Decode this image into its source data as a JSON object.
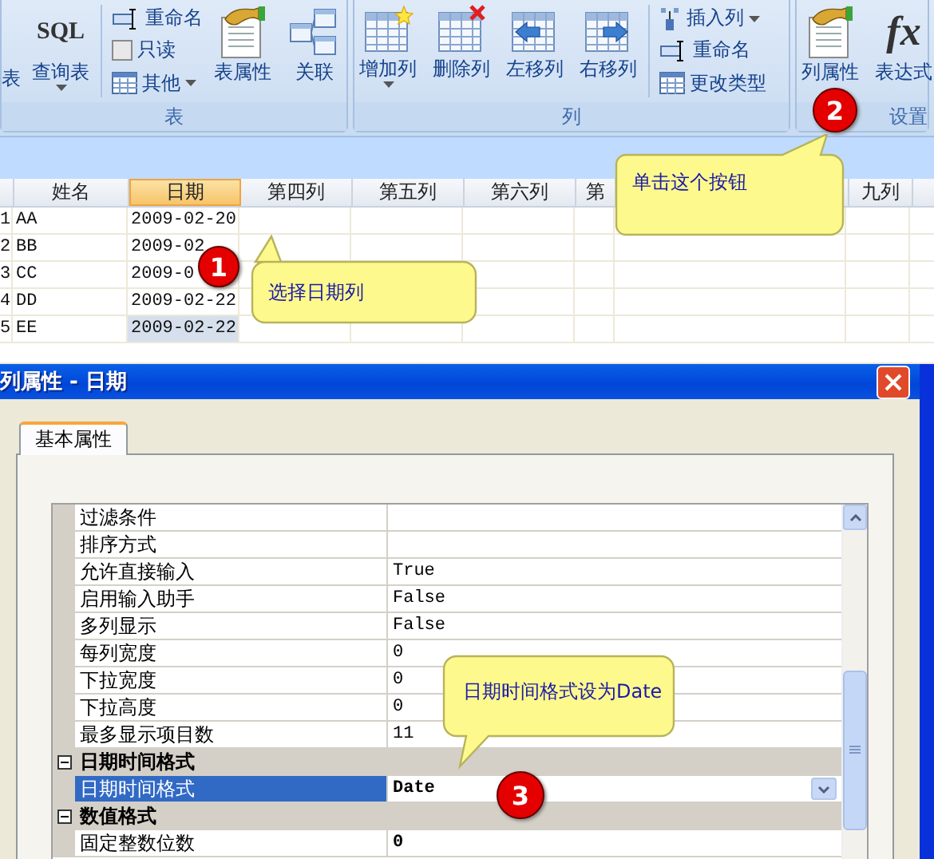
{
  "ribbon": {
    "groups": [
      {
        "label": "表",
        "items": [
          {
            "kind": "partial",
            "label": "表"
          },
          {
            "kind": "large",
            "label": "查询表",
            "icon_text": "SQL",
            "dropdown": true
          },
          {
            "kind": "stack",
            "items": [
              {
                "kind": "rename",
                "label": "重命名"
              },
              {
                "kind": "check",
                "label": "只读",
                "checked": false
              },
              {
                "kind": "grid",
                "label": "其他",
                "dropdown": true
              }
            ]
          },
          {
            "kind": "large",
            "label": "表属性",
            "dropdown": false
          },
          {
            "kind": "large",
            "label": "关联",
            "dropdown": false
          }
        ]
      },
      {
        "label": "列",
        "items": [
          {
            "kind": "large",
            "label": "增加列",
            "dropdown": true
          },
          {
            "kind": "large",
            "label": "删除列",
            "dropdown": false
          },
          {
            "kind": "large",
            "label": "左移列",
            "dropdown": false
          },
          {
            "kind": "large",
            "label": "右移列",
            "dropdown": false
          },
          {
            "kind": "stack",
            "items": [
              {
                "kind": "insert",
                "label": "插入列",
                "dropdown": true
              },
              {
                "kind": "rename",
                "label": "重命名"
              },
              {
                "kind": "grid",
                "label": "更改类型"
              }
            ]
          }
        ]
      },
      {
        "label": "设置",
        "items": [
          {
            "kind": "large",
            "label": "列属性",
            "dropdown": false
          },
          {
            "kind": "large",
            "label": "表达式",
            "icon_text": "fx",
            "dropdown": false
          }
        ]
      }
    ]
  },
  "grid": {
    "columns": [
      {
        "label": "姓名",
        "selected": false
      },
      {
        "label": "日期",
        "selected": true
      },
      {
        "label": "第四列",
        "selected": false
      },
      {
        "label": "第五列",
        "selected": false
      },
      {
        "label": "第六列",
        "selected": false
      },
      {
        "label": "第",
        "selected": false
      },
      {
        "label": "九列",
        "selected": false
      }
    ],
    "rows": [
      {
        "num": "1",
        "name": "AA",
        "date": "2009-02-20",
        "selected": false
      },
      {
        "num": "2",
        "name": "BB",
        "date": "2009-02",
        "selected": false
      },
      {
        "num": "3",
        "name": "CC",
        "date": "2009-0",
        "selected": false
      },
      {
        "num": "4",
        "name": "DD",
        "date": "2009-02-22",
        "selected": false
      },
      {
        "num": "5",
        "name": "EE",
        "date": "2009-02-22",
        "selected": true
      }
    ]
  },
  "dialog": {
    "title": "列属性 - 日期",
    "tabs": [
      {
        "label": "基本属性",
        "selected": true
      }
    ],
    "properties": [
      {
        "kind": "property",
        "name": "过滤条件",
        "selected": false
      },
      {
        "kind": "property",
        "name": "排序方式",
        "selected": false
      },
      {
        "kind": "property",
        "name": "允许直接输入",
        "value": "True",
        "bold": false,
        "selected": false
      },
      {
        "kind": "property",
        "name": "启用输入助手",
        "value": "False",
        "bold": false,
        "selected": false
      },
      {
        "kind": "property",
        "name": "多列显示",
        "value": "False",
        "bold": false,
        "selected": false
      },
      {
        "kind": "property",
        "name": "每列宽度",
        "value": "0",
        "bold": false,
        "selected": false
      },
      {
        "kind": "property",
        "name": "下拉宽度",
        "value": "0",
        "bold": false,
        "selected": false
      },
      {
        "kind": "property",
        "name": "下拉高度",
        "value": "0",
        "bold": false,
        "selected": false
      },
      {
        "kind": "property",
        "name": "最多显示项目数",
        "value": "11",
        "bold": false,
        "selected": false
      },
      {
        "kind": "category",
        "name": "日期时间格式",
        "expanded": true
      },
      {
        "kind": "property",
        "name": "日期时间格式",
        "value": "Date",
        "bold": true,
        "selected": true
      },
      {
        "kind": "category",
        "name": "数值格式",
        "expanded": true
      },
      {
        "kind": "property",
        "name": "固定整数位数",
        "value": "0",
        "bold": true,
        "selected": false
      }
    ]
  },
  "callouts": [
    {
      "number": "1",
      "text": "选择日期列"
    },
    {
      "number": "2",
      "text": "单击这个按钮"
    },
    {
      "number": "3",
      "text": "日期时间格式设为Date"
    }
  ]
}
